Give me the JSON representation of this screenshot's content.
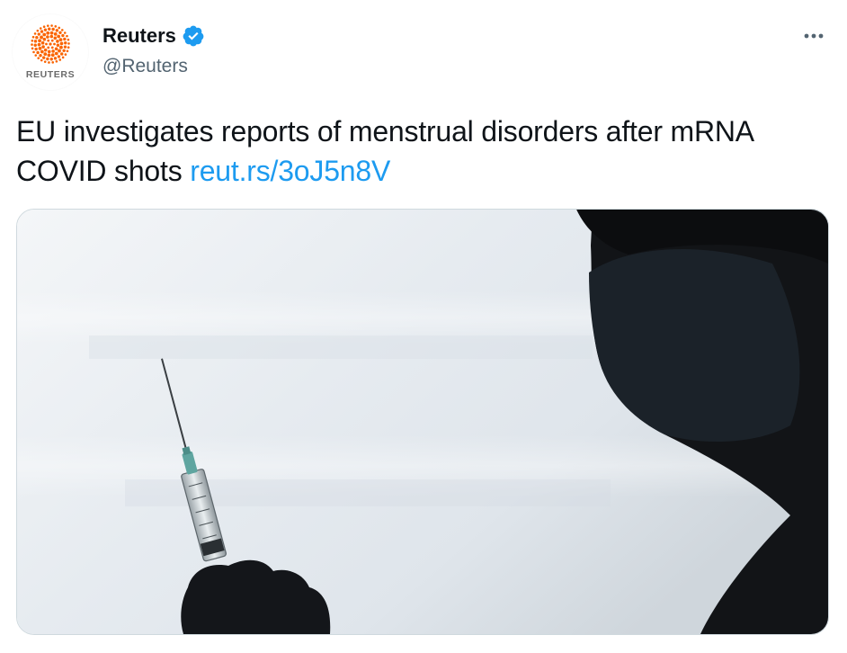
{
  "author": {
    "display_name": "Reuters",
    "handle": "@Reuters",
    "verified": true,
    "avatar_wordmark": "REUTERS",
    "avatar_icon": "reuters-dot-logo",
    "brand_color": "#fa6400"
  },
  "menu": {
    "icon": "more-horizontal-icon"
  },
  "tweet": {
    "text": "EU investigates reports of menstrual disorders after mRNA COVID shots",
    "link_text": "reut.rs/3oJ5n8V"
  },
  "media": {
    "subject": "photo-syringe-silhouette"
  },
  "colors": {
    "text": "#0f1419",
    "secondary_text": "#536471",
    "link": "#1d9bf0",
    "verified_badge": "#1d9bf0",
    "border": "#cfd9de"
  }
}
